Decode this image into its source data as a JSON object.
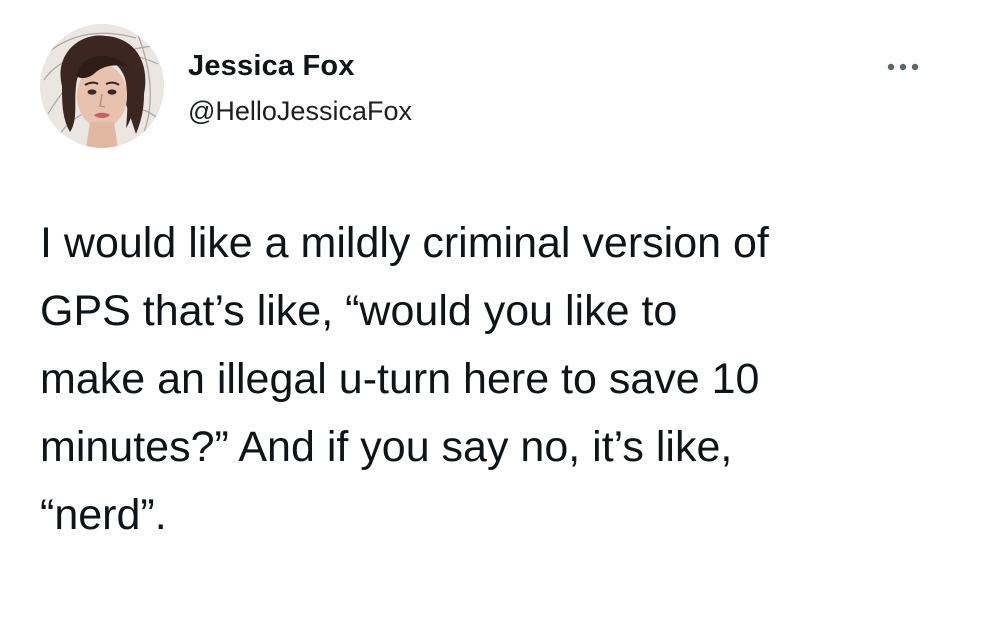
{
  "tweet": {
    "author": {
      "display_name": "Jessica Fox",
      "handle": "@HelloJessicaFox",
      "avatar_icon": "profile-photo"
    },
    "more_icon": "ellipsis-icon",
    "text_lines": [
      "I would like a mildly criminal version of",
      "GPS that’s like, “would you like to",
      "make an illegal u-turn here to save 10",
      "minutes?” And if you say no, it’s like,",
      "“nerd”."
    ]
  },
  "colors": {
    "background": "#ffffff",
    "text": "#0f1419",
    "handle": "#1c1f23"
  }
}
